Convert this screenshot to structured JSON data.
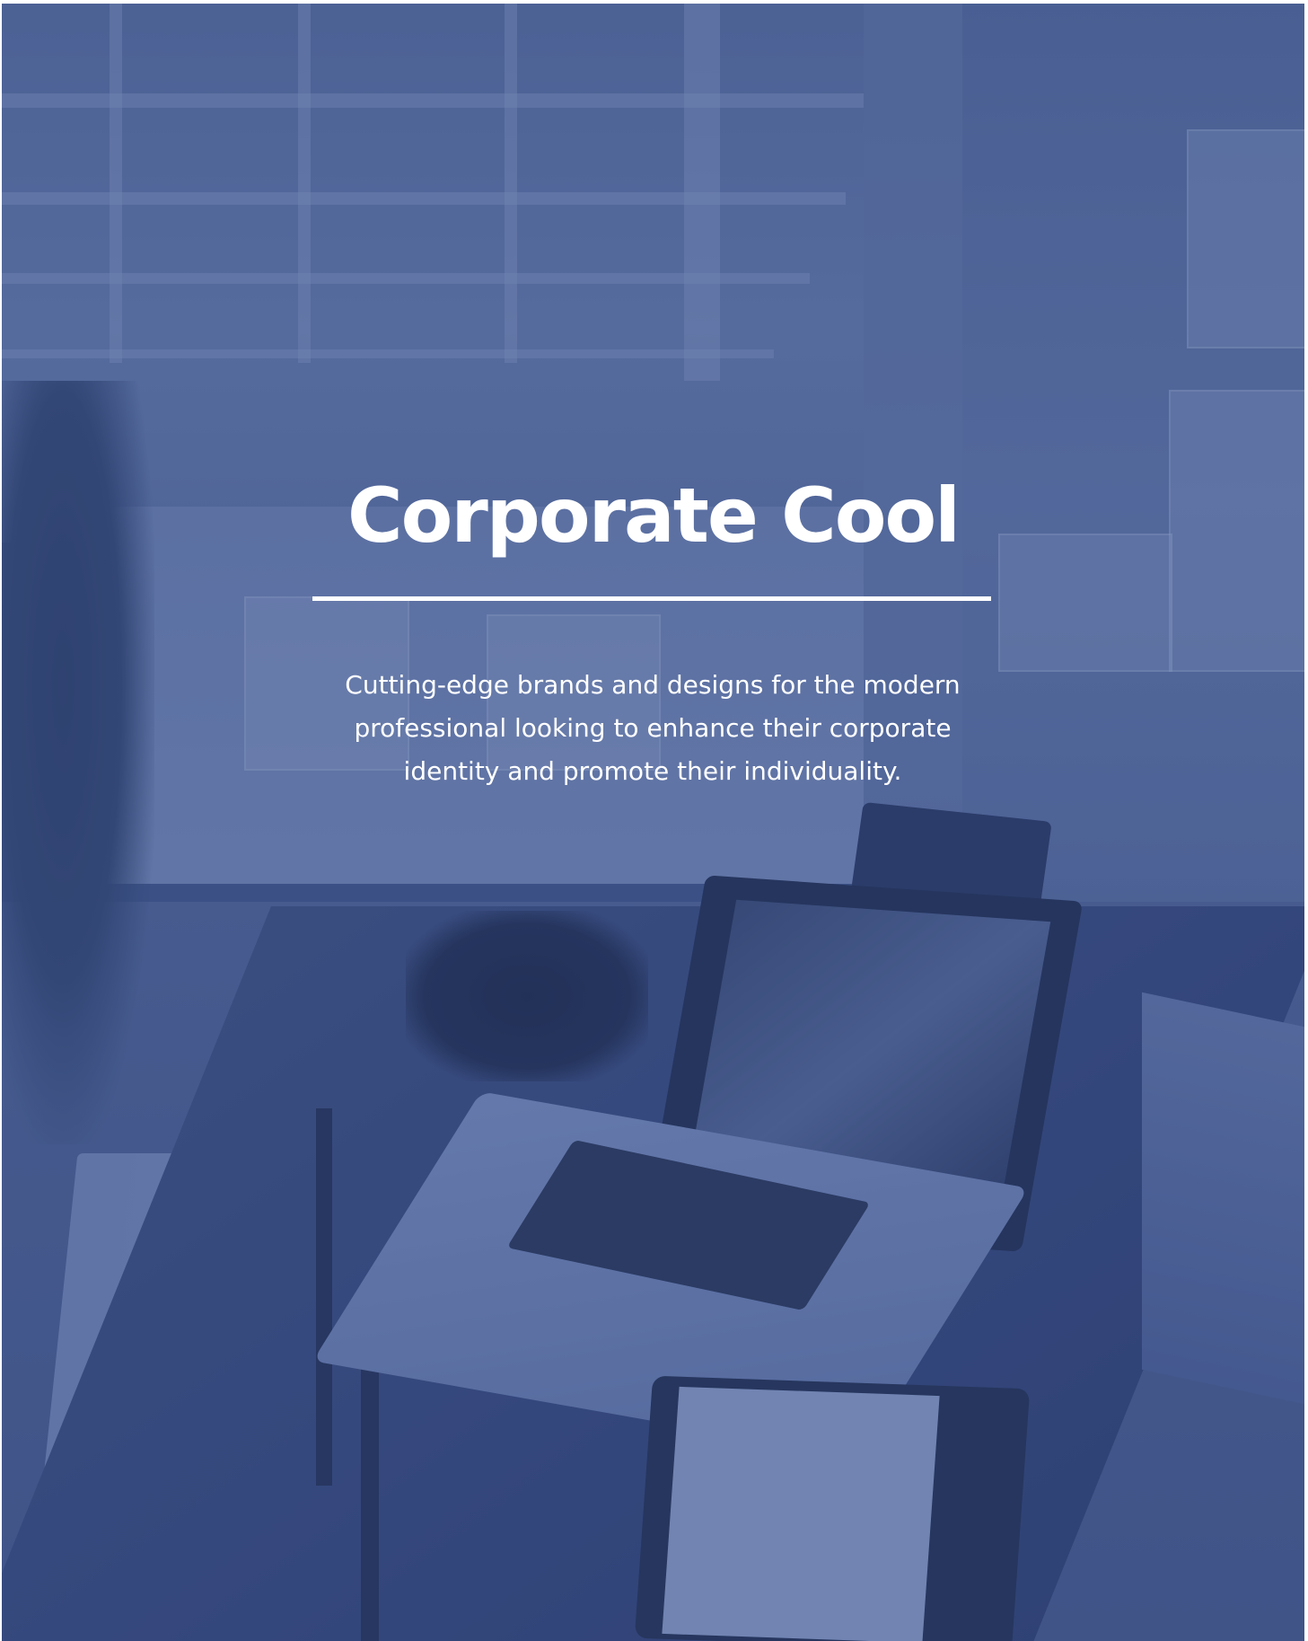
{
  "hero": {
    "title": "Corporate Cool",
    "tagline": "Cutting-edge brands and designs for the modern professional looking to enhance their corporate identity and promote their individuality."
  },
  "colors": {
    "overlay": "#42588a",
    "text": "#ffffff",
    "divider": "#ffffff"
  }
}
